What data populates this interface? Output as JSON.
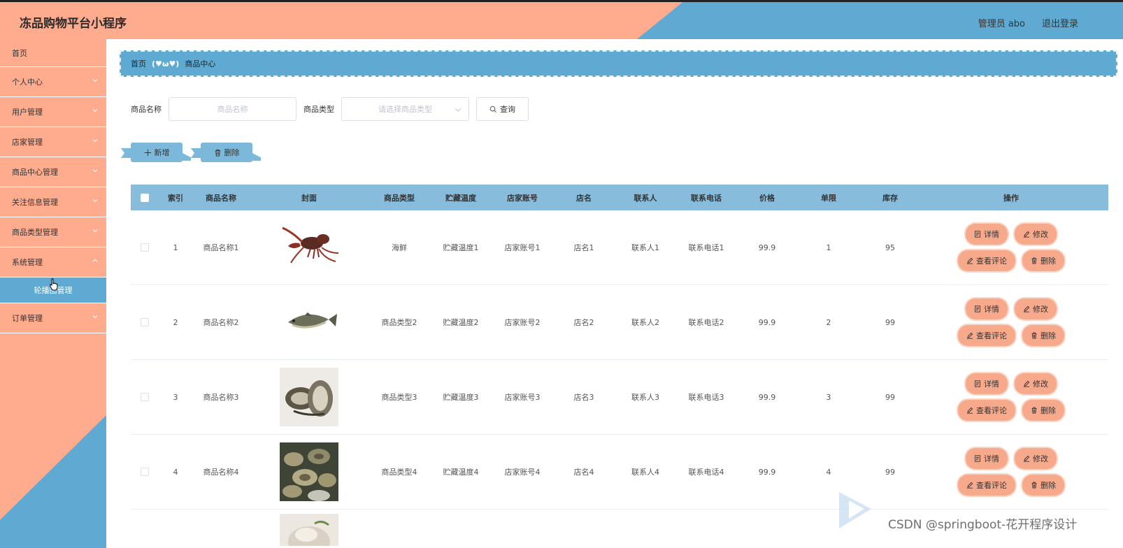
{
  "app": {
    "title": "冻品购物平台小程序",
    "user_label": "管理员 abo",
    "logout": "退出登录"
  },
  "sidebar": {
    "items": [
      {
        "label": "首页"
      },
      {
        "label": "个人中心"
      },
      {
        "label": "用户管理"
      },
      {
        "label": "店家管理"
      },
      {
        "label": "商品中心管理"
      },
      {
        "label": "关注信息管理"
      },
      {
        "label": "商品类型管理"
      },
      {
        "label": "系统管理"
      },
      {
        "label": "轮播图管理"
      },
      {
        "label": "订单管理"
      }
    ]
  },
  "breadcrumb": {
    "home": "首页",
    "separator": "(♥ω♥)",
    "current": "商品中心"
  },
  "search": {
    "name_label": "商品名称",
    "name_placeholder": "商品名称",
    "type_label": "商品类型",
    "type_placeholder": "请选择商品类型",
    "query_button": "查询"
  },
  "actions": {
    "add": "新增",
    "delete": "删除"
  },
  "table": {
    "headers": {
      "index": "索引",
      "name": "商品名称",
      "cover": "封面",
      "type": "商品类型",
      "temp": "贮藏温度",
      "account": "店家账号",
      "shop": "店名",
      "contact": "联系人",
      "phone": "联系电话",
      "price": "价格",
      "limit": "单限",
      "stock": "库存",
      "ops": "操作"
    },
    "op_labels": {
      "detail": "详情",
      "edit": "修改",
      "comments": "查看评论",
      "delete": "删除"
    },
    "rows": [
      {
        "index": "1",
        "name": "商品名称1",
        "type": "海鲜",
        "temp": "贮藏温度1",
        "account": "店家账号1",
        "shop": "店名1",
        "contact": "联系人1",
        "phone": "联系电话1",
        "price": "99.9",
        "limit": "1",
        "stock": "95",
        "cover": "crayfish"
      },
      {
        "index": "2",
        "name": "商品名称2",
        "type": "商品类型2",
        "temp": "贮藏温度2",
        "account": "店家账号2",
        "shop": "店名2",
        "contact": "联系人2",
        "phone": "联系电话2",
        "price": "99.9",
        "limit": "2",
        "stock": "99",
        "cover": "fish"
      },
      {
        "index": "3",
        "name": "商品名称3",
        "type": "商品类型3",
        "temp": "贮藏温度3",
        "account": "店家账号3",
        "shop": "店名3",
        "contact": "联系人3",
        "phone": "联系电话3",
        "price": "99.9",
        "limit": "3",
        "stock": "99",
        "cover": "oysters"
      },
      {
        "index": "4",
        "name": "商品名称4",
        "type": "商品类型4",
        "temp": "贮藏温度4",
        "account": "店家账号4",
        "shop": "店名4",
        "contact": "联系人4",
        "phone": "联系电话4",
        "price": "99.9",
        "limit": "4",
        "stock": "99",
        "cover": "clams"
      }
    ]
  },
  "watermark": "CSDN @springboot-花开程序设计",
  "colors": {
    "primary_orange": "#ffab8d",
    "primary_blue": "#5eaad2",
    "table_header": "#87bcdc",
    "pill": "#f7a98c"
  }
}
